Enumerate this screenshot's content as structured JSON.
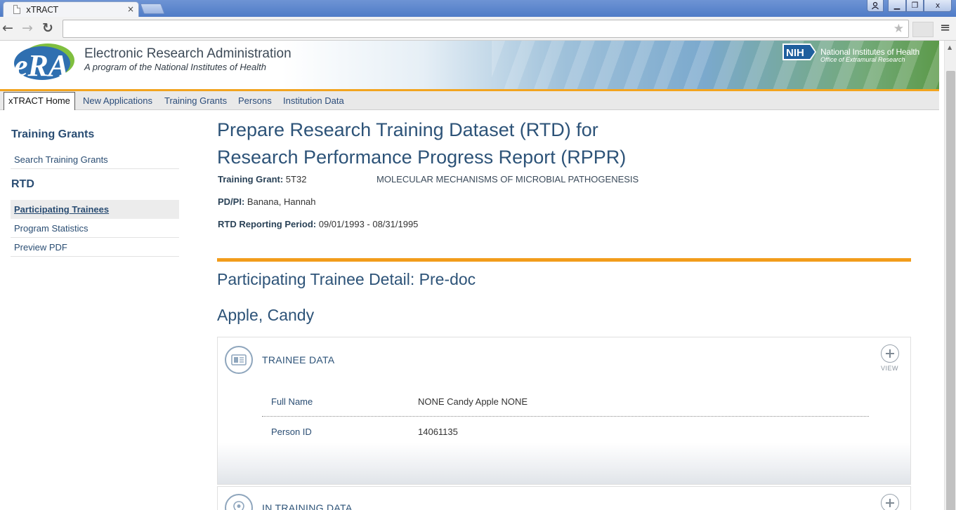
{
  "browser": {
    "tab_title": "xTRACT",
    "tab_close": "×",
    "window_buttons": {
      "minimize": "▁",
      "maximize": "❐",
      "close": "x"
    }
  },
  "banner": {
    "title": "Electronic Research Administration",
    "subtitle": "A program of the National Institutes of Health",
    "logo_text": "eRA",
    "nih_badge": "NIH",
    "nih_name": "National Institutes of Health",
    "nih_office": "Office of  Extramural Research"
  },
  "menu": {
    "items": [
      {
        "label": "xTRACT Home"
      },
      {
        "label": "New Applications"
      },
      {
        "label": "Training Grants"
      },
      {
        "label": "Persons"
      },
      {
        "label": "Institution Data"
      }
    ]
  },
  "sidebar": {
    "heading_grants": "Training Grants",
    "search_link": "Search Training Grants",
    "heading_rtd": "RTD",
    "links": [
      {
        "label": "Participating Trainees"
      },
      {
        "label": "Program Statistics"
      },
      {
        "label": "Preview PDF"
      }
    ]
  },
  "main": {
    "title_line1": "Prepare Research Training Dataset (RTD) for",
    "title_line2": "Research Performance Progress Report (RPPR)",
    "training_grant_label": "Training Grant:",
    "training_grant_value": "5T32",
    "training_grant_title": "MOLECULAR MECHANISMS OF MICROBIAL PATHOGENESIS",
    "pdpi_label": "PD/PI:",
    "pdpi_value": "Banana, Hannah",
    "period_label": "RTD Reporting Period:",
    "period_value": "09/01/1993 - 08/31/1995",
    "detail_title": "Participating Trainee Detail: Pre-doc",
    "trainee_name": "Apple, Candy"
  },
  "trainee_panel": {
    "heading": "TRAINEE DATA",
    "view_label": "VIEW",
    "fields": [
      {
        "label": "Full Name",
        "value": "NONE Candy Apple NONE"
      },
      {
        "label": "Person ID",
        "value": "14061135"
      }
    ]
  },
  "in_training_panel": {
    "heading": "IN TRAINING DATA"
  },
  "colors": {
    "accent_orange": "#f29c1b",
    "heading_blue": "#2d5378",
    "chrome_blue": "#4f7cc7"
  }
}
